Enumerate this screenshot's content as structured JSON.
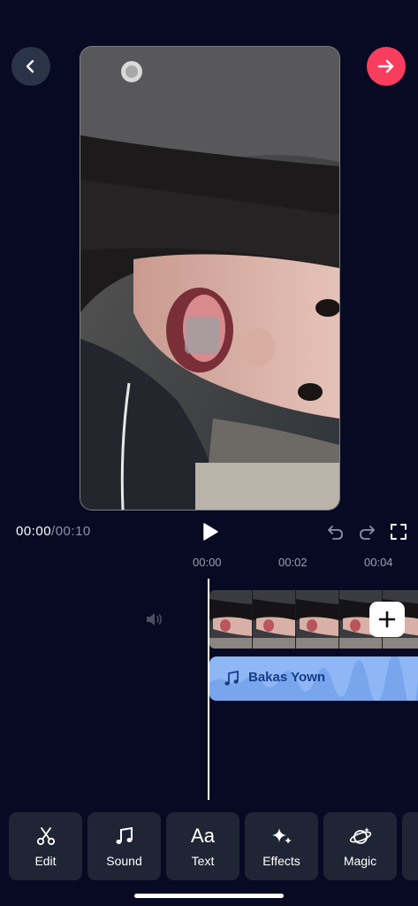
{
  "header": {
    "back_icon": "chevron-left-icon",
    "next_icon": "arrow-right-icon",
    "next_color": "#f83d5e"
  },
  "playback": {
    "current_time": "00:00",
    "separator": "/",
    "total_time": "00:10"
  },
  "ruler": {
    "ticks": [
      "00:00",
      "00:02",
      "00:04"
    ]
  },
  "audio": {
    "track_name": "Bakas Yown"
  },
  "toolbar": {
    "items": [
      {
        "label": "Edit",
        "icon": "scissors-icon"
      },
      {
        "label": "Sound",
        "icon": "music-note-icon"
      },
      {
        "label": "Text",
        "icon": "text-aa-icon"
      },
      {
        "label": "Effects",
        "icon": "sparkles-icon"
      },
      {
        "label": "Magic",
        "icon": "magic-planet-icon"
      }
    ]
  }
}
